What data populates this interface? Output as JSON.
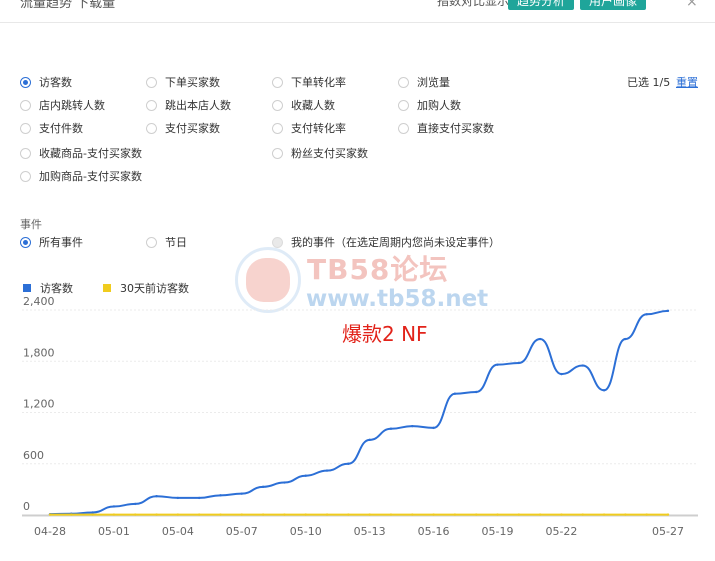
{
  "header": {
    "title": "流量趋势 下载量",
    "subtitle": "指数对比显示",
    "btn_primary": "趋势分析",
    "btn_secondary": "用户画像",
    "close": "×"
  },
  "metrics": [
    {
      "label": "访客数",
      "checked": true
    },
    {
      "label": "下单买家数",
      "checked": false
    },
    {
      "label": "下单转化率",
      "checked": false
    },
    {
      "label": "浏览量",
      "checked": false
    },
    {
      "label": "店内跳转人数",
      "checked": false
    },
    {
      "label": "跳出本店人数",
      "checked": false
    },
    {
      "label": "收藏人数",
      "checked": false
    },
    {
      "label": "加购人数",
      "checked": false
    },
    {
      "label": "支付件数",
      "checked": false
    },
    {
      "label": "支付买家数",
      "checked": false
    },
    {
      "label": "支付转化率",
      "checked": false
    },
    {
      "label": "直接支付买家数",
      "checked": false
    },
    {
      "label": "收藏商品-支付买家数",
      "checked": false
    },
    {
      "label": "粉丝支付买家数",
      "checked": false
    },
    {
      "label": "加购商品-支付买家数",
      "checked": false
    }
  ],
  "selection": {
    "info": "已选 1/5",
    "reset": "重置"
  },
  "events": {
    "label": "事件",
    "options": [
      {
        "label": "所有事件",
        "checked": true
      },
      {
        "label": "节日",
        "checked": false
      },
      {
        "label": "我的事件（在选定周期内您尚未设定事件）",
        "checked": false,
        "disabled": true
      }
    ]
  },
  "watermark": {
    "line1": "TB58论坛",
    "line2": "www.tb58.net"
  },
  "annotation": "爆款2 NF",
  "colors": {
    "series1": "#2c6fd6",
    "series2": "#f0cc1e",
    "accent": "#1fa59a"
  },
  "chart_data": {
    "type": "line",
    "x": [
      "04-28",
      "04-29",
      "04-30",
      "05-01",
      "05-02",
      "05-03",
      "05-04",
      "05-05",
      "05-06",
      "05-07",
      "05-08",
      "05-09",
      "05-10",
      "05-11",
      "05-12",
      "05-13",
      "05-14",
      "05-15",
      "05-16",
      "05-17",
      "05-18",
      "05-19",
      "05-20",
      "05-21",
      "05-22",
      "05-23",
      "05-24",
      "05-25",
      "05-26",
      "05-27"
    ],
    "xticks": [
      "04-28",
      "05-01",
      "05-04",
      "05-07",
      "05-10",
      "05-13",
      "05-16",
      "05-19",
      "05-22",
      "05-27"
    ],
    "series": [
      {
        "name": "访客数",
        "values": [
          10,
          15,
          30,
          100,
          130,
          220,
          200,
          200,
          230,
          250,
          330,
          380,
          460,
          520,
          600,
          880,
          1010,
          1040,
          1020,
          1420,
          1440,
          1760,
          1780,
          2060,
          1650,
          1750,
          1460,
          2060,
          2350,
          2390
        ]
      },
      {
        "name": "30天前访客数",
        "values": [
          5,
          5,
          5,
          5,
          5,
          5,
          5,
          5,
          5,
          5,
          5,
          5,
          5,
          5,
          5,
          5,
          5,
          5,
          5,
          5,
          5,
          5,
          5,
          5,
          5,
          5,
          5,
          5,
          5,
          5
        ]
      }
    ],
    "yticks": [
      0,
      600,
      1200,
      1800,
      2400
    ],
    "ylim": [
      0,
      2400
    ],
    "grid": true,
    "legend": "top-left"
  }
}
